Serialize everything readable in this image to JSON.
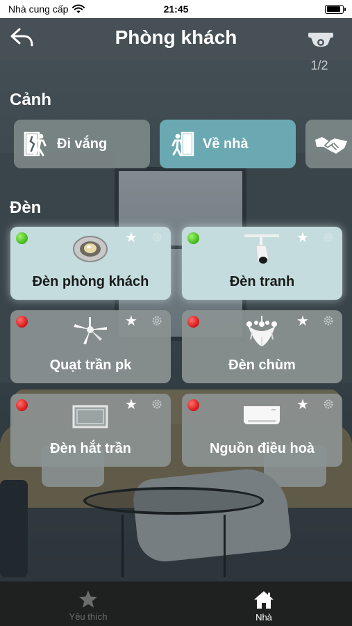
{
  "status_bar": {
    "carrier": "Nhà cung cấp",
    "time": "21:45",
    "battery_level": 0.9
  },
  "header": {
    "title": "Phòng khách",
    "back_icon": "back-arrow-icon",
    "camera_icon": "security-camera-icon",
    "page_indicator": "1/2"
  },
  "scenes": {
    "title": "Cảnh",
    "items": [
      {
        "label": "Đi vắng",
        "icon": "leave-home-icon",
        "active": false
      },
      {
        "label": "Về nhà",
        "icon": "come-home-icon",
        "active": true
      },
      {
        "label": "",
        "icon": "handshake-icon",
        "active": false
      }
    ]
  },
  "lights": {
    "title": "Đèn",
    "items": [
      {
        "label": "Đèn phòng khách",
        "status": "on",
        "status_color": "#3fb31c",
        "icon": "downlight-icon"
      },
      {
        "label": "Đèn tranh",
        "status": "on",
        "status_color": "#3fb31c",
        "icon": "track-light-icon"
      },
      {
        "label": "Quạt trần pk",
        "status": "off",
        "status_color": "#d31414",
        "icon": "ceiling-fan-icon"
      },
      {
        "label": "Đèn chùm",
        "status": "off",
        "status_color": "#d31414",
        "icon": "chandelier-icon"
      },
      {
        "label": "Đèn hắt trần",
        "status": "off",
        "status_color": "#d31414",
        "icon": "cove-light-icon"
      },
      {
        "label": "Nguồn điều hoà",
        "status": "off",
        "status_color": "#d31414",
        "icon": "air-conditioner-icon"
      }
    ]
  },
  "tabbar": {
    "items": [
      {
        "label": "Yêu thích",
        "icon": "star-icon",
        "active": false
      },
      {
        "label": "Nhà",
        "icon": "home-icon",
        "active": true
      }
    ]
  },
  "colors": {
    "scene_active": "#6aa9b2",
    "card_on": "#c4dcdd",
    "card_off": "#8c9292",
    "status_on": "#3fb31c",
    "status_off": "#d31414"
  }
}
